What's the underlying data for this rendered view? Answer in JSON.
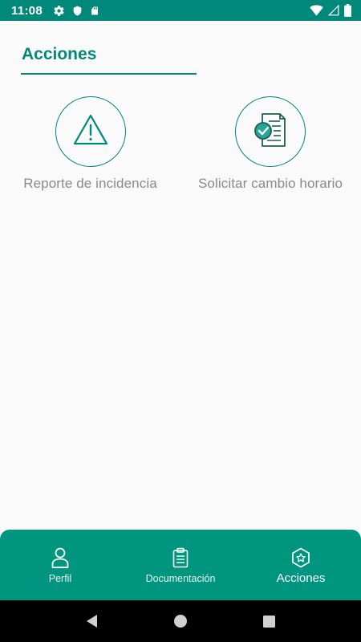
{
  "status_bar": {
    "time": "11:08",
    "left_icons": [
      "gear-icon",
      "shield-icon",
      "sd-card-icon"
    ],
    "right_icons": [
      "wifi-icon",
      "signal-icon",
      "battery-icon"
    ]
  },
  "page": {
    "title": "Acciones"
  },
  "actions": [
    {
      "label": "Reporte de incidencia",
      "icon": "warning-icon"
    },
    {
      "label": "Solicitar cambio horario",
      "icon": "document-check-icon"
    }
  ],
  "bottom_nav": {
    "items": [
      {
        "label": "Perfil",
        "icon": "person-icon",
        "active": false
      },
      {
        "label": "Documentación",
        "icon": "clipboard-icon",
        "active": false
      },
      {
        "label": "Acciones",
        "icon": "star-badge-icon",
        "active": true
      }
    ]
  },
  "system_nav": [
    "back-icon",
    "home-icon",
    "recents-icon"
  ],
  "colors": {
    "primary": "#00897b",
    "nav_background": "#00957f",
    "label_grey": "#8a8a8a",
    "background": "#fafafa"
  }
}
